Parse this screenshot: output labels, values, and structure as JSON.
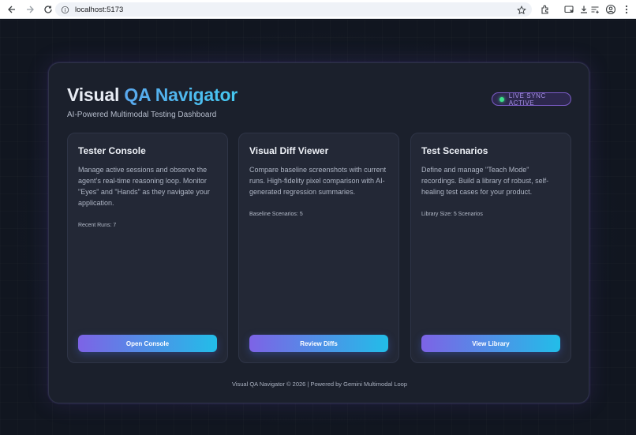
{
  "browser": {
    "url": "localhost:5173"
  },
  "header": {
    "title_plain": "Visual ",
    "title_accent": "QA Navigator",
    "subtitle": "AI-Powered Multimodal Testing Dashboard",
    "badge": "LIVE SYNC ACTIVE"
  },
  "cards": [
    {
      "title": "Tester Console",
      "description": "Manage active sessions and observe the agent’s real-time reasoning loop. Monitor \"Eyes\" and \"Hands\" as they navigate your application.",
      "stat": "Recent Runs: 7",
      "button": "Open Console"
    },
    {
      "title": "Visual Diff Viewer",
      "description": "Compare baseline screenshots with current runs. High-fidelity pixel comparison with AI-generated regression summaries.",
      "stat": "Baseline Scenarios: 5",
      "button": "Review Diffs"
    },
    {
      "title": "Test Scenarios",
      "description": "Define and manage \"Teach Mode\" recordings. Build a library of robust, self-healing test cases for your product.",
      "stat": "Library Size: 5 Scenarios",
      "button": "View Library"
    }
  ],
  "footer": "Visual QA Navigator © 2026 | Powered by Gemini Multimodal Loop",
  "colors": {
    "background": "#111620",
    "panel": "#1b202c",
    "card": "#232836",
    "accent_purple": "#7d63e6",
    "accent_cyan": "#22bde8",
    "live_dot": "#3ee08a"
  }
}
